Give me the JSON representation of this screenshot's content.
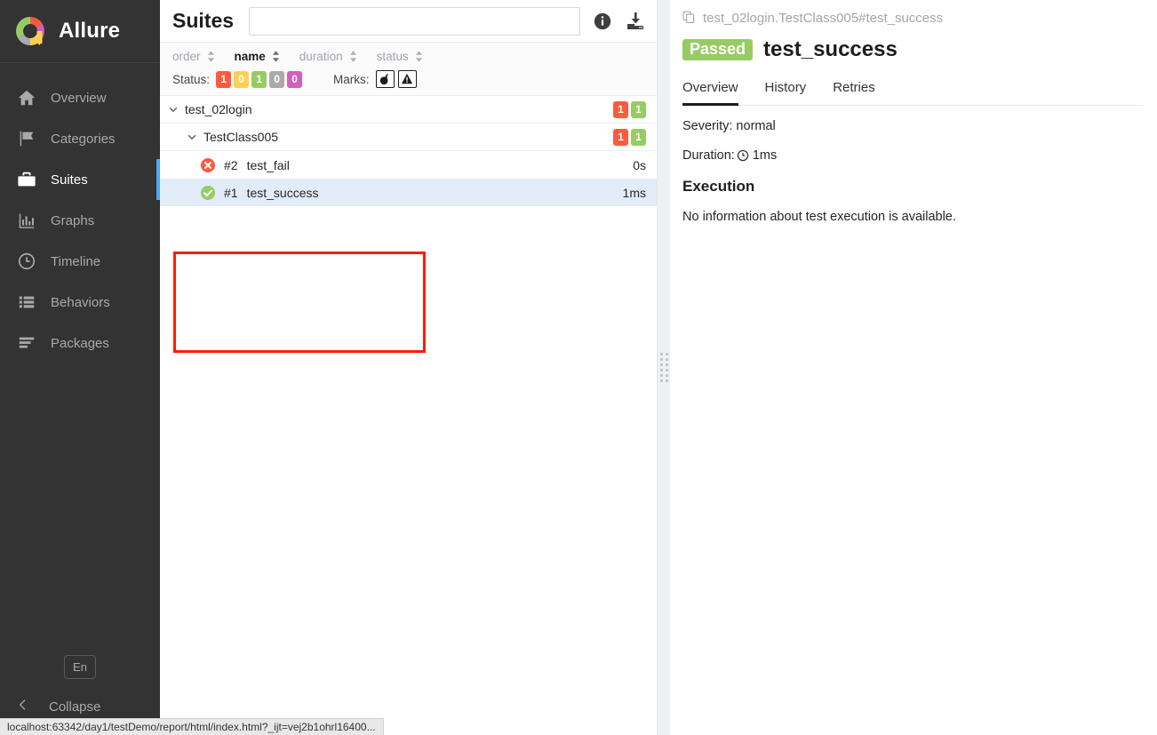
{
  "sidebar": {
    "brand": {
      "name": "Allure",
      "logo_icon": "allure-donut-logo"
    },
    "items": [
      {
        "label": "Overview",
        "icon": "home-icon",
        "active": false
      },
      {
        "label": "Categories",
        "icon": "flag-icon",
        "active": false
      },
      {
        "label": "Suites",
        "icon": "briefcase-icon",
        "active": true
      },
      {
        "label": "Graphs",
        "icon": "bar-chart-icon",
        "active": false
      },
      {
        "label": "Timeline",
        "icon": "clock-icon",
        "active": false
      },
      {
        "label": "Behaviors",
        "icon": "list-icon",
        "active": false
      },
      {
        "label": "Packages",
        "icon": "stack-icon",
        "active": false
      }
    ],
    "language_button": "En",
    "collapse_label": "Collapse",
    "collapse_icon": "chevron-left-icon",
    "active_color": "#4fa7f0"
  },
  "suites": {
    "title": "Suites",
    "search": {
      "value": "",
      "placeholder": ""
    },
    "header_icons": [
      {
        "name": "info-icon"
      },
      {
        "name": "download-icon"
      }
    ],
    "sort_columns": [
      {
        "label": "order",
        "active": false
      },
      {
        "label": "name",
        "active": true
      },
      {
        "label": "duration",
        "active": false
      },
      {
        "label": "status",
        "active": false
      }
    ],
    "status_filter": {
      "label": "Status:",
      "chips": [
        {
          "value": "1",
          "color": "#fd5a3e",
          "status": "failed"
        },
        {
          "value": "0",
          "color": "#ffd050",
          "status": "broken"
        },
        {
          "value": "1",
          "color": "#97cc64",
          "status": "passed"
        },
        {
          "value": "0",
          "color": "#aaaaaa",
          "status": "skipped"
        },
        {
          "value": "0",
          "color": "#d35ebe",
          "status": "unknown"
        }
      ]
    },
    "marks_filter": {
      "label": "Marks:",
      "marks": [
        {
          "name": "bomb-icon"
        },
        {
          "name": "warning-triangle-icon"
        }
      ]
    },
    "tree": [
      {
        "name": "test_02login",
        "level": 1,
        "expanded": true,
        "badges": [
          {
            "value": "1",
            "color": "#fd5a3e"
          },
          {
            "value": "1",
            "color": "#97cc64"
          }
        ]
      },
      {
        "name": "TestClass005",
        "level": 2,
        "expanded": true,
        "badges": [
          {
            "value": "1",
            "color": "#fd5a3e"
          },
          {
            "value": "1",
            "color": "#97cc64"
          }
        ]
      }
    ],
    "tests": [
      {
        "status": "failed",
        "status_icon": "failed-circle-icon",
        "order": "#2",
        "name": "test_fail",
        "duration": "0s",
        "selected": false
      },
      {
        "status": "passed",
        "status_icon": "passed-circle-icon",
        "order": "#1",
        "name": "test_success",
        "duration": "1ms",
        "selected": true
      }
    ],
    "highlight_color": "#fc1c08"
  },
  "detail": {
    "breadcrumb": "test_02login.TestClass005#test_success",
    "breadcrumb_icon": "copy-icon",
    "status_tag": "Passed",
    "status_tag_color": "#97cc64",
    "title": "test_success",
    "tabs": [
      {
        "label": "Overview",
        "active": true
      },
      {
        "label": "History",
        "active": false
      },
      {
        "label": "Retries",
        "active": false
      }
    ],
    "severity": "Severity: normal",
    "duration_label": "Duration:",
    "duration_value": "1ms",
    "duration_icon": "clock-icon",
    "execution_heading": "Execution",
    "execution_text": "No information about test execution is available."
  },
  "statusbar": {
    "url": "localhost:63342/day1/testDemo/report/html/index.html?_ijt=vej2b1ohrl16400..."
  }
}
